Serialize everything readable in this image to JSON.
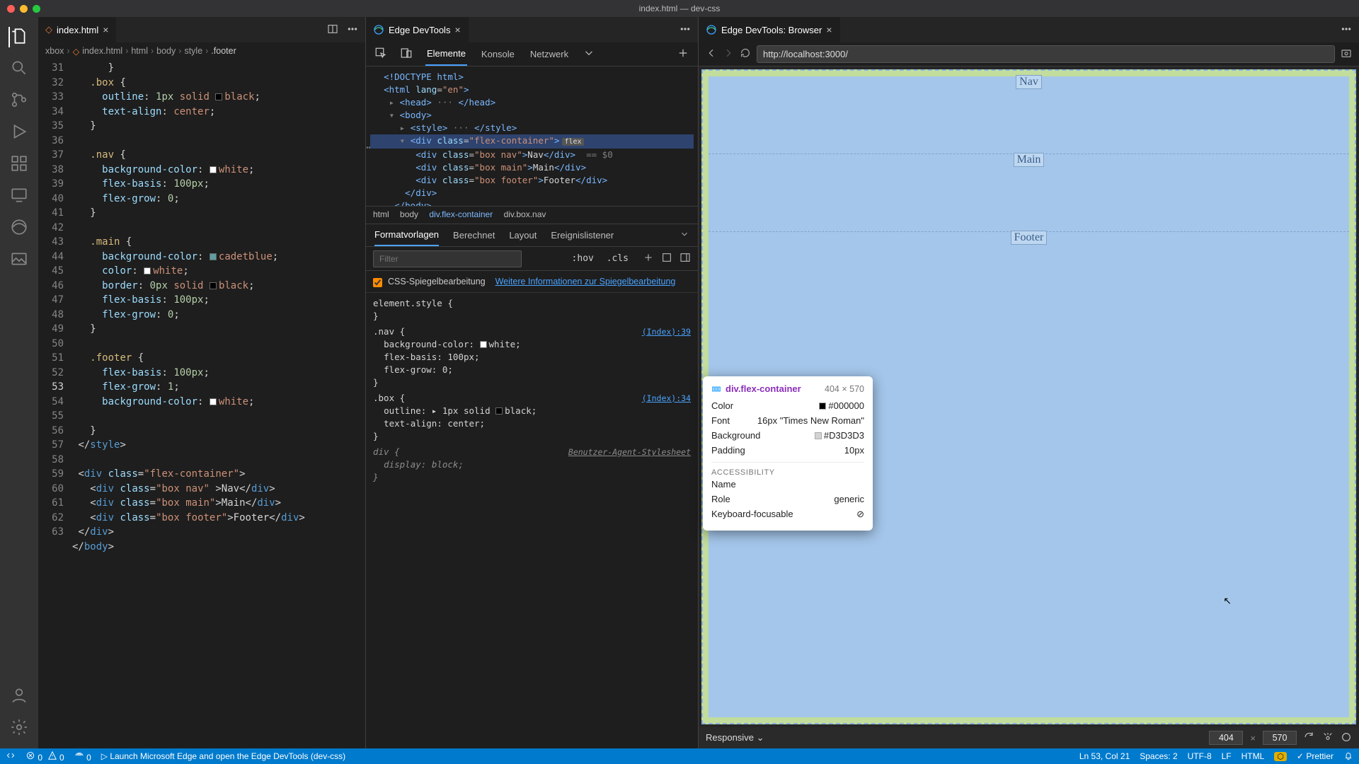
{
  "window": {
    "title": "index.html — dev-css"
  },
  "editor_tab": {
    "label": "index.html"
  },
  "devtools_tab": {
    "label": "Edge DevTools"
  },
  "browser_tab": {
    "label": "Edge DevTools: Browser"
  },
  "breadcrumbs": {
    "b0": "xbox",
    "b1": "index.html",
    "b2": "html",
    "b3": "body",
    "b4": "style",
    "b5": ".footer"
  },
  "editor_lines": {
    "start": 31,
    "active": 53
  },
  "devtools": {
    "tabs": {
      "elements": "Elemente",
      "console": "Konsole",
      "network": "Netzwerk"
    },
    "dom_path": {
      "p0": "html",
      "p1": "body",
      "p2": "div.flex-container",
      "p3": "div.box.nav"
    },
    "styles_tabs": {
      "t0": "Formatvorlagen",
      "t1": "Berechnet",
      "t2": "Layout",
      "t3": "Ereignislistener"
    },
    "filter_placeholder": "Filter",
    "hov": ":hov",
    "cls": ".cls",
    "mirror_label": "CSS-Spiegelbearbeitung",
    "mirror_link": "Weitere Informationen zur Spiegelbearbeitung",
    "styles": {
      "element_style": "element.style {",
      "rule_nav_sel": ".nav {",
      "rule_nav_src": "(Index):39",
      "rule_nav_p1": "background-color:",
      "rule_nav_v1": "white",
      "rule_nav_p2": "flex-basis:",
      "rule_nav_v2": "100px",
      "rule_nav_p3": "flex-grow:",
      "rule_nav_v3": "0",
      "rule_box_sel": ".box {",
      "rule_box_src": "(Index):34",
      "rule_box_p1": "outline:",
      "rule_box_v1": "1px solid",
      "rule_box_v1b": "black",
      "rule_box_p2": "text-align:",
      "rule_box_v2": "center",
      "rule_div_sel": "div {",
      "rule_div_src": "Benutzer-Agent-Stylesheet",
      "rule_div_p1": "display:",
      "rule_div_v1": "block"
    }
  },
  "dom_text": {
    "doctype": "<!DOCTYPE html>",
    "html_open": "<html lang=\"en\">",
    "head": "<head> ··· </head>",
    "body_open": "<body>",
    "style": "<style> ··· </style>",
    "flex_open": "<div class=\"flex-container\">",
    "flex_badge": "flex",
    "nav_line": "<div class=\"box nav\">Nav</div>",
    "nav_hint": "== $0",
    "main_line": "<div class=\"box main\">Main</div>",
    "footer_line": "<div class=\"box footer\">Footer</div>",
    "div_close": "</div>",
    "body_close": "</body>"
  },
  "browser": {
    "url": "http://localhost:3000/",
    "labels": {
      "nav": "Nav",
      "main": "Main",
      "footer": "Footer"
    },
    "responsive_label": "Responsive",
    "width": "404",
    "height": "570"
  },
  "inspect": {
    "selector": "div.flex-container",
    "dims": "404 × 570",
    "color_label": "Color",
    "color_val": "#000000",
    "font_label": "Font",
    "font_val": "16px \"Times New Roman\"",
    "bg_label": "Background",
    "bg_val": "#D3D3D3",
    "pad_label": "Padding",
    "pad_val": "10px",
    "a11y_header": "ACCESSIBILITY",
    "name_label": "Name",
    "name_val": "",
    "role_label": "Role",
    "role_val": "generic",
    "focus_label": "Keyboard-focusable"
  },
  "statusbar": {
    "remote": "",
    "errors": "0",
    "warnings": "0",
    "ports": "0",
    "launch": "Launch Microsoft Edge and open the Edge DevTools (dev-css)",
    "line_col": "Ln 53, Col 21",
    "spaces": "Spaces: 2",
    "enc": "UTF-8",
    "eol": "LF",
    "lang": "HTML",
    "prettier": "Prettier"
  }
}
